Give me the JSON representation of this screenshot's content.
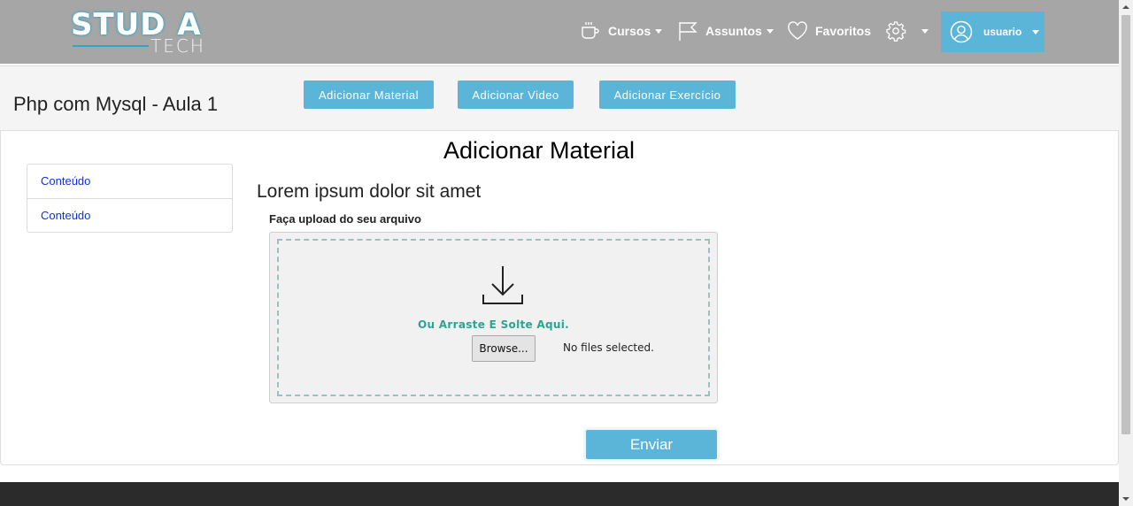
{
  "navbar": {
    "logo_main": "STUD A",
    "logo_sub": "TECH",
    "cursos_label": "Cursos",
    "assuntos_label": "Assuntos",
    "favoritos_label": "Favoritos",
    "user_label": "usuario"
  },
  "header": {
    "page_title": "Php com Mysql - Aula 1",
    "buttons": [
      "Adicionar Material",
      "Adicionar Video",
      "Adicionar Exercício"
    ]
  },
  "main": {
    "title": "Adicionar Material",
    "sidebar_items": [
      "Conteúdo",
      "Conteúdo"
    ],
    "subtitle": "Lorem ipsum dolor sit amet",
    "upload_label": "Faça upload do seu arquivo",
    "drop_text": "Ou Arraste E Solte Aqui.",
    "browse_label": "Browse...",
    "file_status": "No files selected.",
    "submit_label": "Enviar"
  },
  "colors": {
    "navbar_bg": "#a6a6a6",
    "accent": "#5bb5d8",
    "drop_text": "#2aa58f",
    "link": "#0b33e0",
    "footer_bg": "#2b2b2b"
  },
  "icons": [
    "coffee-cup-icon",
    "flag-icon",
    "heart-icon",
    "gear-icon",
    "user-circle-icon",
    "download-icon"
  ]
}
